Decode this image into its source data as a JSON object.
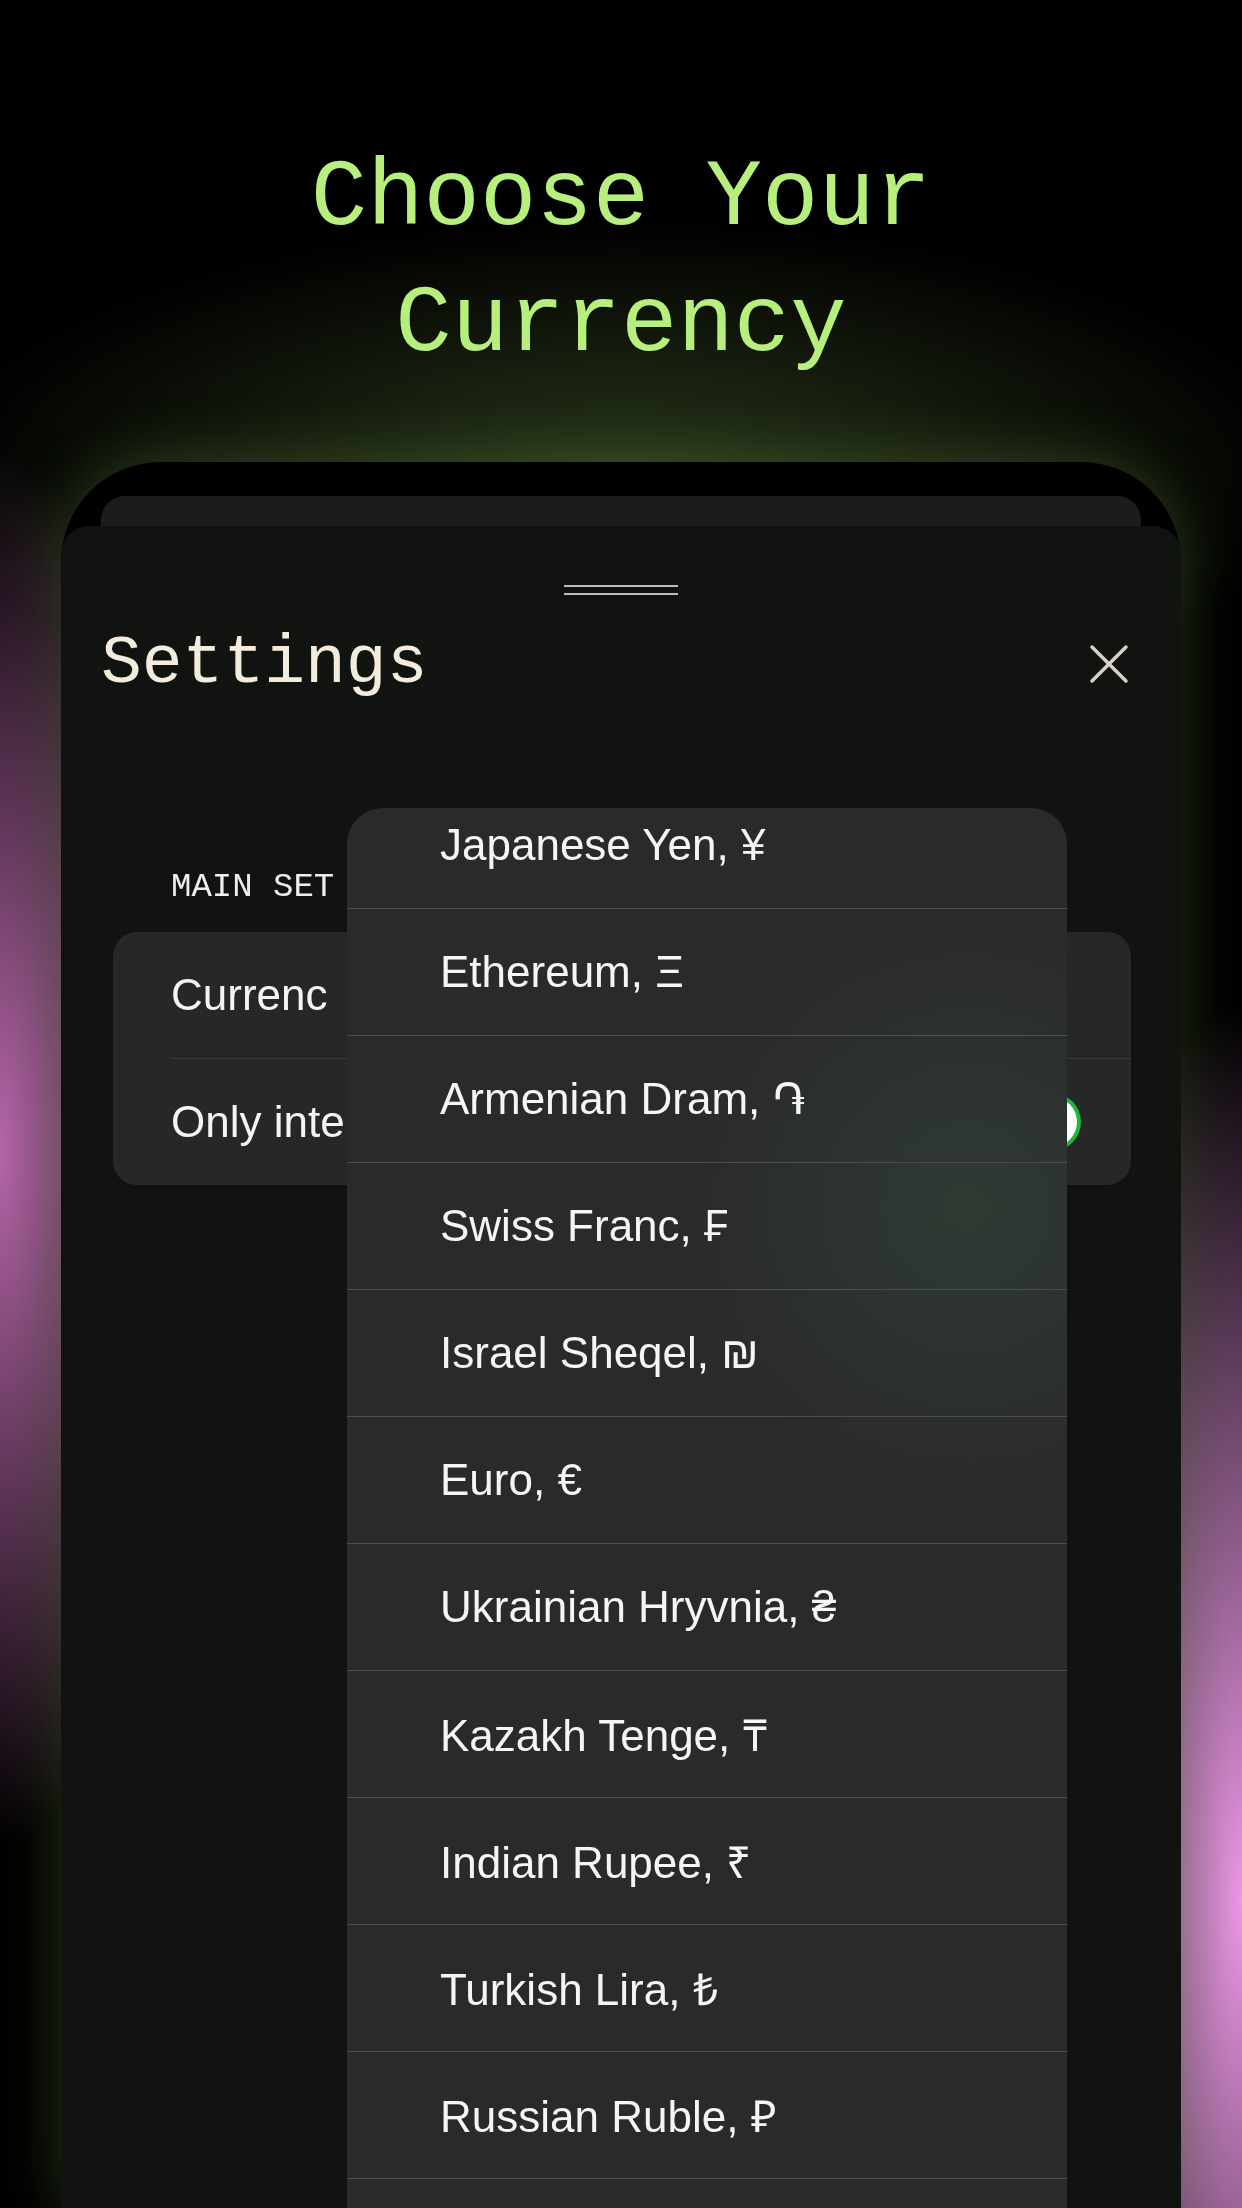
{
  "headline": "Choose Your Currency",
  "sheet": {
    "title": "Settings",
    "section_label": "MAIN SET",
    "rows": [
      {
        "kind": "link",
        "label": "Currenc"
      },
      {
        "kind": "toggle",
        "label": "Only inte",
        "on": true
      }
    ]
  },
  "currency_menu": {
    "items": [
      {
        "label": "Japanese Yen, ¥"
      },
      {
        "label": "Ethereum, Ξ"
      },
      {
        "label": "Armenian Dram, ֏"
      },
      {
        "label": "Swiss Franc, ₣"
      },
      {
        "label": "Israel Sheqel, ₪"
      },
      {
        "label": "Euro, €"
      },
      {
        "label": "Ukrainian Hryvnia, ₴"
      },
      {
        "label": "Kazakh Tenge, ₸"
      },
      {
        "label": "Indian Rupee, ₹"
      },
      {
        "label": "Turkish Lira, ₺"
      },
      {
        "label": "Russian Ruble, ₽"
      }
    ]
  }
}
